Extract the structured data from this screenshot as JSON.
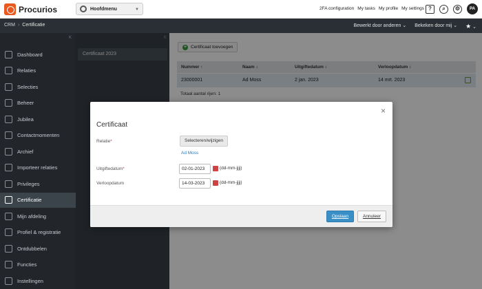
{
  "header": {
    "logo": "Procurios",
    "main_menu": "Hoofdmenu",
    "links": [
      "2FA configuration",
      "My tasks",
      "My profile",
      "My settings"
    ],
    "avatar": "PA"
  },
  "crumbbar": {
    "root": "CRM",
    "separator": "›",
    "current": "Certificatie",
    "edited_by": "Bewerkt door anderen",
    "viewed_by": "Bekeken door mij"
  },
  "sidebar": {
    "items": [
      {
        "label": "Dashboard",
        "icon": "search-icon"
      },
      {
        "label": "Relaties",
        "icon": "people-icon"
      },
      {
        "label": "Selecties",
        "icon": "selection-icon"
      },
      {
        "label": "Beheer",
        "icon": "manage-icon"
      },
      {
        "label": "Jubilea",
        "icon": "medal-icon"
      },
      {
        "label": "Contactmomenten",
        "icon": "handshake-icon"
      },
      {
        "label": "Archief",
        "icon": "archive-icon"
      },
      {
        "label": "Importeer relaties",
        "icon": "import-icon"
      },
      {
        "label": "Privileges",
        "icon": "key-icon"
      },
      {
        "label": "Certificatie",
        "icon": "certificate-icon",
        "active": true
      },
      {
        "label": "Mijn afdeling",
        "icon": "building-icon"
      },
      {
        "label": "Profiel & registratie",
        "icon": "profile-icon"
      },
      {
        "label": "Ontdubbelen",
        "icon": "merge-icon"
      },
      {
        "label": "Functies",
        "icon": "functions-icon"
      },
      {
        "label": "Instellingen",
        "icon": "settings-icon"
      }
    ]
  },
  "subpanel": {
    "item": "Certificaat 2023"
  },
  "content": {
    "add_button": "Certificaat toevoegen",
    "columns": [
      "Nummer ↑",
      "Naam ↕",
      "Uitgiftedatum ↕",
      "Verloopdatum ↕"
    ],
    "rows": [
      {
        "nummer": "23000001",
        "naam": "Ad Moss",
        "uitgiftedatum": "2 jan. 2023",
        "verloopdatum": "14 mrt. 2023"
      }
    ],
    "total": "Totaal aantal rijen: 1"
  },
  "modal": {
    "title": "Certificaat",
    "relatie_label": "Relatie",
    "select_button": "Selecteren/wijzigen",
    "selected_relation": "Ad Moss",
    "issue_label": "Uitgiftedatum",
    "issue_value": "02-01-2023",
    "expiry_label": "Verloopdatum",
    "expiry_value": "14-03-2023",
    "date_hint": "(dd-mm-jjjj)",
    "save": "Opslaan",
    "cancel": "Annuleer",
    "close": "×"
  }
}
